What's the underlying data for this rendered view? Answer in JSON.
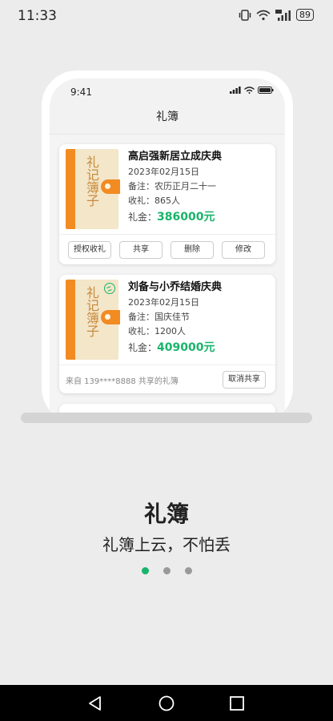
{
  "status_bar": {
    "time": "11:33",
    "battery": "89"
  },
  "inner_status": {
    "time": "9:41"
  },
  "inner_title": "礼簿",
  "book_cover_text": "礼记簿子",
  "cards": [
    {
      "title": "高启强新居立成庆典",
      "date": "2023年02月15日",
      "note": "备注：农历正月二十一",
      "count": "收礼：865人",
      "amount_label": "礼金：",
      "amount": "386000元",
      "buttons": [
        "授权收礼",
        "共享",
        "删除",
        "修改"
      ]
    },
    {
      "title": "刘备与小乔结婚庆典",
      "date": "2023年02月15日",
      "note": "备注：国庆佳节",
      "count": "收礼：1200人",
      "amount_label": "礼金：",
      "amount": "409000元",
      "from_text": "来自 139****8888 共享的礼簿",
      "cancel_share": "取消共享"
    }
  ],
  "slogan": {
    "title": "礼簿",
    "subtitle": "礼簿上云，不怕丢"
  },
  "pagination": {
    "total": 3,
    "active": 1
  },
  "colors": {
    "accent": "#18b46b",
    "book_orange": "#f28b22",
    "book_paper": "#f3e6c9"
  },
  "icons": [
    "vibrate-icon",
    "wifi-icon",
    "signal-4g-icon",
    "battery-icon",
    "cellular-icon",
    "share-icon",
    "back-icon",
    "home-icon",
    "recents-icon"
  ]
}
